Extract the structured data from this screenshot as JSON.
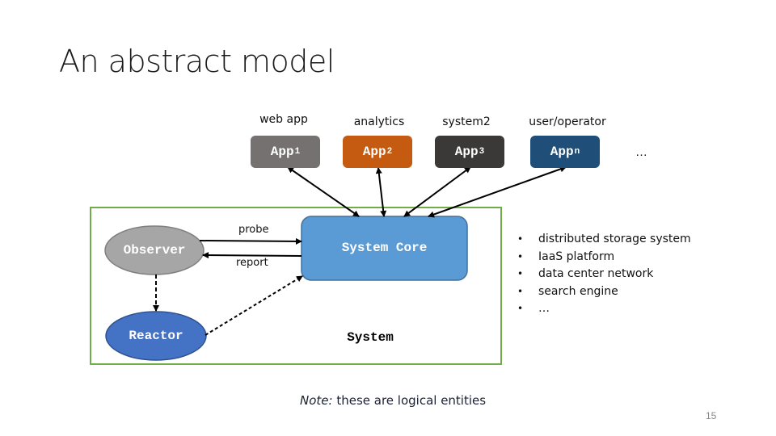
{
  "slide": {
    "title": "An abstract model",
    "page_number": "15"
  },
  "apps": [
    {
      "role": "web app",
      "name": "App",
      "subscript": "1",
      "color": "#767171"
    },
    {
      "role": "analytics",
      "name": "App",
      "subscript": "2",
      "color": "#C55A11"
    },
    {
      "role": "system2",
      "name": "App",
      "subscript": "3",
      "color": "#3B3838"
    },
    {
      "role": "user/operator",
      "name": "App",
      "subscript": "n",
      "color": "#1F4E79"
    }
  ],
  "apps_more": "…",
  "system": {
    "label": "System",
    "border_color": "#70AD47",
    "core": {
      "label": "System Core",
      "color": "#5B9BD5",
      "border": "#41719C"
    },
    "observer": {
      "label": "Observer",
      "color": "#A6A6A6",
      "border": "#7F7F7F"
    },
    "reactor": {
      "label": "Reactor",
      "color": "#4472C4",
      "border": "#2F528F"
    },
    "edges": {
      "probe": "probe",
      "report": "report"
    }
  },
  "examples": [
    "distributed storage system",
    "IaaS platform",
    "data center network",
    "search engine",
    "…"
  ],
  "note": {
    "prefix": "Note:",
    "text": " these are logical entities"
  }
}
